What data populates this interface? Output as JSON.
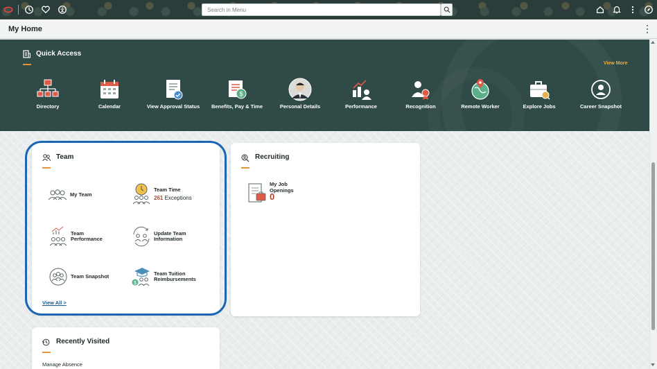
{
  "topbar": {
    "search_placeholder": "Search in Menu"
  },
  "header": {
    "title": "My Home"
  },
  "quick_access": {
    "title": "Quick Access",
    "view_more": "View More",
    "tiles": [
      {
        "label": "Directory",
        "icon": "org-chart-icon"
      },
      {
        "label": "Calendar",
        "icon": "calendar-icon"
      },
      {
        "label": "View Approval Status",
        "icon": "approval-status-icon"
      },
      {
        "label": "Benefits, Pay & Time",
        "icon": "benefits-icon"
      },
      {
        "label": "Personal Details",
        "icon": "avatar-photo"
      },
      {
        "label": "Performance",
        "icon": "performance-icon"
      },
      {
        "label": "Recognition",
        "icon": "recognition-icon"
      },
      {
        "label": "Remote Worker",
        "icon": "remote-worker-icon"
      },
      {
        "label": "Explore Jobs",
        "icon": "briefcase-icon"
      },
      {
        "label": "Career Snapshot",
        "icon": "career-snapshot-icon"
      }
    ]
  },
  "team_card": {
    "title": "Team",
    "items": {
      "my_team": "My Team",
      "team_time": "Team Time",
      "exceptions_count": "261",
      "exceptions_label": "Exceptions",
      "team_performance": "Team Performance",
      "update_team_information": "Update Team Information",
      "team_snapshot": "Team Snapshot",
      "team_tuition": "Team Tuition Reimbursements"
    },
    "view_all": "View All >"
  },
  "recruiting_card": {
    "title": "Recruiting",
    "openings_label": "My Job Openings",
    "openings_count": "0"
  },
  "recent_card": {
    "title": "Recently Visited",
    "items": [
      "Manage Absence"
    ]
  },
  "colors": {
    "banner": "#2f4a47",
    "accent_underline": "#e8923a",
    "highlight_outline": "#1a66b3",
    "count_red": "#b3452a"
  }
}
